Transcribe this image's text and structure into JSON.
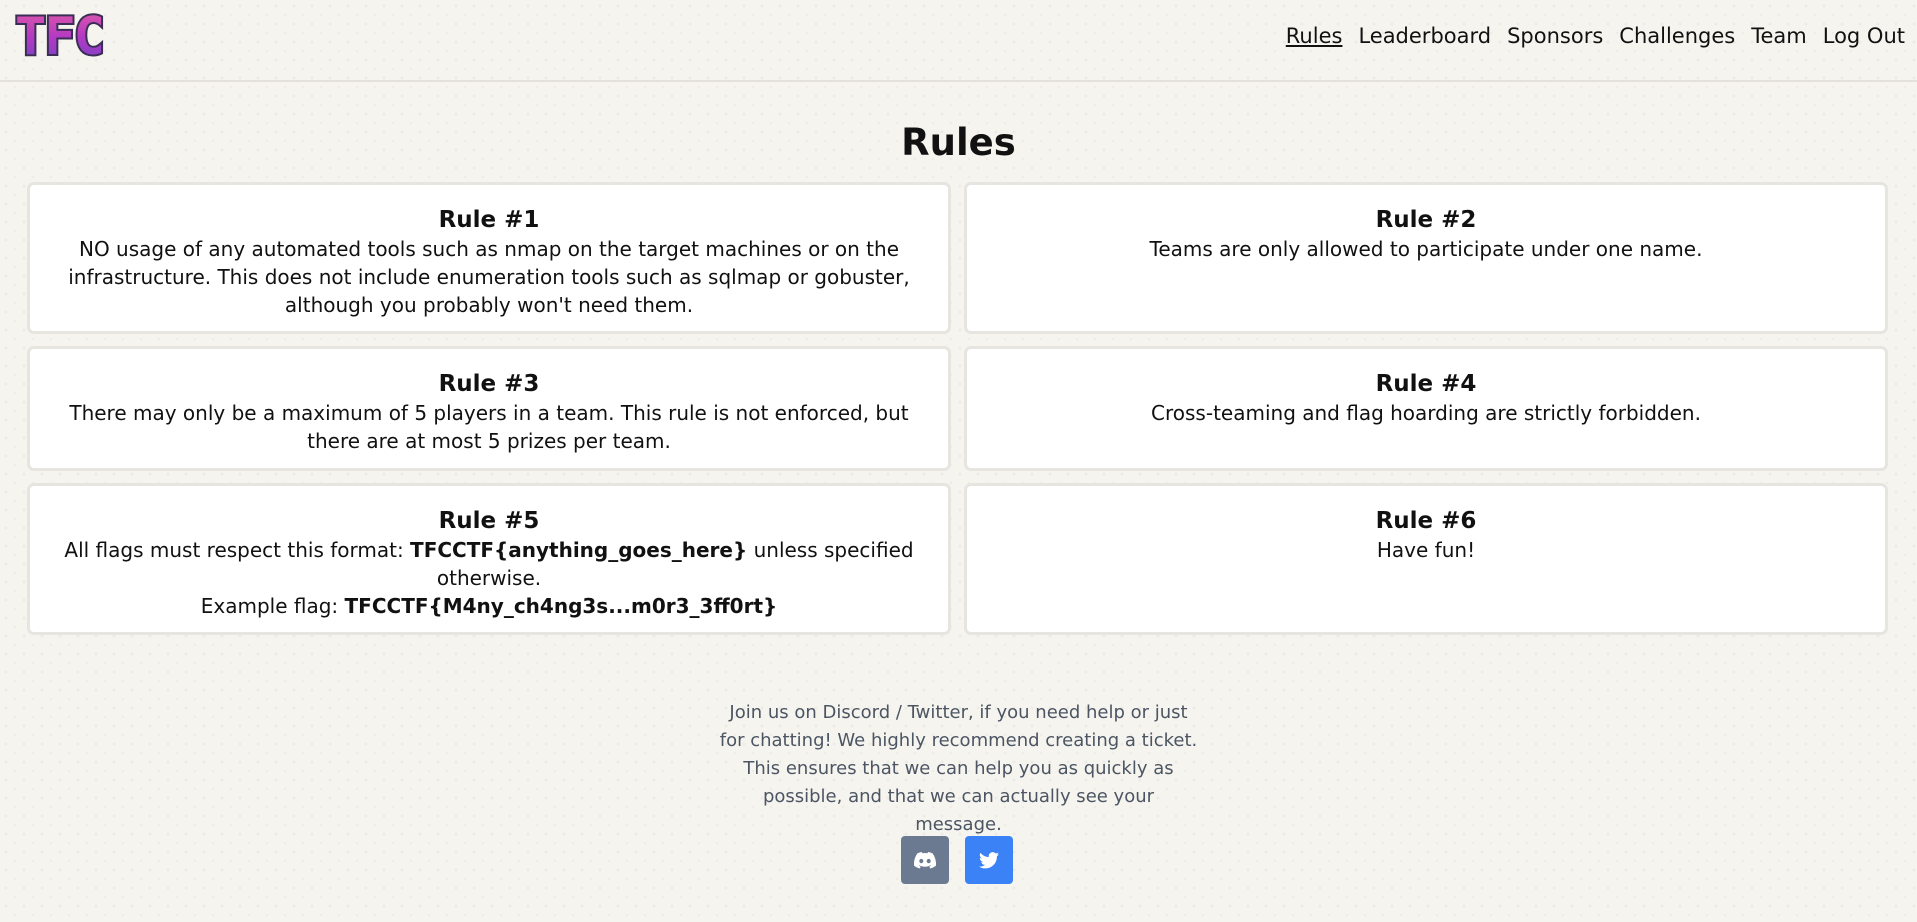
{
  "header": {
    "logo_text": "TFC",
    "nav": {
      "rules": "Rules",
      "leaderboard": "Leaderboard",
      "sponsors": "Sponsors",
      "challenges": "Challenges",
      "team": "Team",
      "logout": "Log Out"
    }
  },
  "page": {
    "title": "Rules"
  },
  "rules": {
    "r1": {
      "title": "Rule #1",
      "text": "NO usage of any automated tools such as nmap on the target machines or on the infrastructure. This does not include enumeration tools such as sqlmap or gobuster, although you probably won't need them."
    },
    "r2": {
      "title": "Rule #2",
      "text": "Teams are only allowed to participate under one name."
    },
    "r3": {
      "title": "Rule #3",
      "text": "There may only be a maximum of 5 players in a team. This rule is not enforced, but there are at most 5 prizes per team."
    },
    "r4": {
      "title": "Rule #4",
      "text": "Cross-teaming and flag hoarding are strictly forbidden."
    },
    "r5": {
      "title": "Rule #5",
      "line1_prefix": "All flags must respect this format: ",
      "format": "TFCCTF{anything_goes_here}",
      "line1_suffix": " unless specified otherwise.",
      "example_prefix": "Example flag: ",
      "example": "TFCCTF{M4ny_ch4ng3s...m0r3_3ff0rt}"
    },
    "r6": {
      "title": "Rule #6",
      "text": "Have fun!"
    }
  },
  "footer": {
    "message": "Join us on Discord / Twitter, if you need help or just for chatting! We highly recommend creating a ticket. This ensures that we can help you as quickly as possible, and that we can actually see your message.",
    "icons": [
      "discord-icon",
      "twitter-icon"
    ]
  },
  "colors": {
    "discord_button": "#6b7a90",
    "twitter_button": "#3b82f6",
    "footer_text": "#4b5563",
    "logo_fill": "#b13fbf",
    "logo_outline": "#3b2e55"
  }
}
